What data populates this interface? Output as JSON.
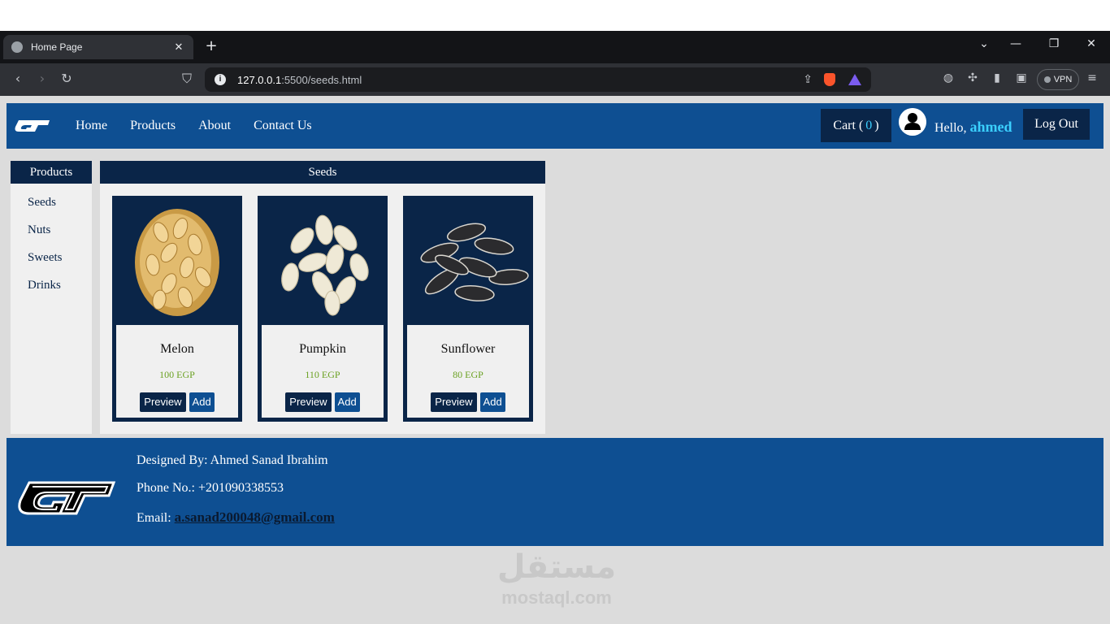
{
  "browser": {
    "tab_title": "Home Page",
    "tab_close": "✕",
    "new_tab": "+",
    "url_host": "127.0.0.1",
    "url_path": ":5500/seeds.html",
    "vpn_label": "VPN",
    "icons": [
      "globe-icon",
      "close-icon",
      "plus-icon",
      "chevron-down-icon",
      "minimize-icon",
      "restore-icon",
      "back-icon",
      "forward-icon",
      "reload-icon",
      "bookmark-icon",
      "info-icon",
      "share-icon",
      "brave-shields-icon",
      "brave-rewards-icon",
      "translate-icon",
      "extensions-icon",
      "sidebar-icon",
      "wallet-icon",
      "menu-icon"
    ]
  },
  "nav": {
    "links": [
      "Home",
      "Products",
      "About",
      "Contact Us"
    ],
    "cart_label": "Cart (",
    "cart_count": "0",
    "cart_close": ")",
    "hello": "Hello,",
    "user": "ahmed",
    "logout": "Log Out"
  },
  "sidebar": {
    "heading": "Products",
    "items": [
      "Seeds",
      "Nuts",
      "Sweets",
      "Drinks"
    ]
  },
  "main": {
    "heading": "Seeds",
    "products": [
      {
        "name": "Melon",
        "price": "100 EGP",
        "preview": "Preview",
        "add": "Add"
      },
      {
        "name": "Pumpkin",
        "price": "110 EGP",
        "preview": "Preview",
        "add": "Add"
      },
      {
        "name": "Sunflower",
        "price": "80 EGP",
        "preview": "Preview",
        "add": "Add"
      }
    ]
  },
  "footer": {
    "designed": "Designed By: Ahmed Sanad Ibrahim",
    "phone": "Phone No.: +201090338553",
    "email_label": "Email:",
    "email": "a.sanad200048@gmail.com"
  },
  "watermark": {
    "arabic": "مستقل",
    "latin": "mostaql.com"
  },
  "colors": {
    "nav_blue": "#0e4f92",
    "dark_navy": "#0a2548",
    "accent_cyan": "#3bd0ff",
    "price_green": "#6aa121",
    "page_bg": "#dcdcdc"
  }
}
